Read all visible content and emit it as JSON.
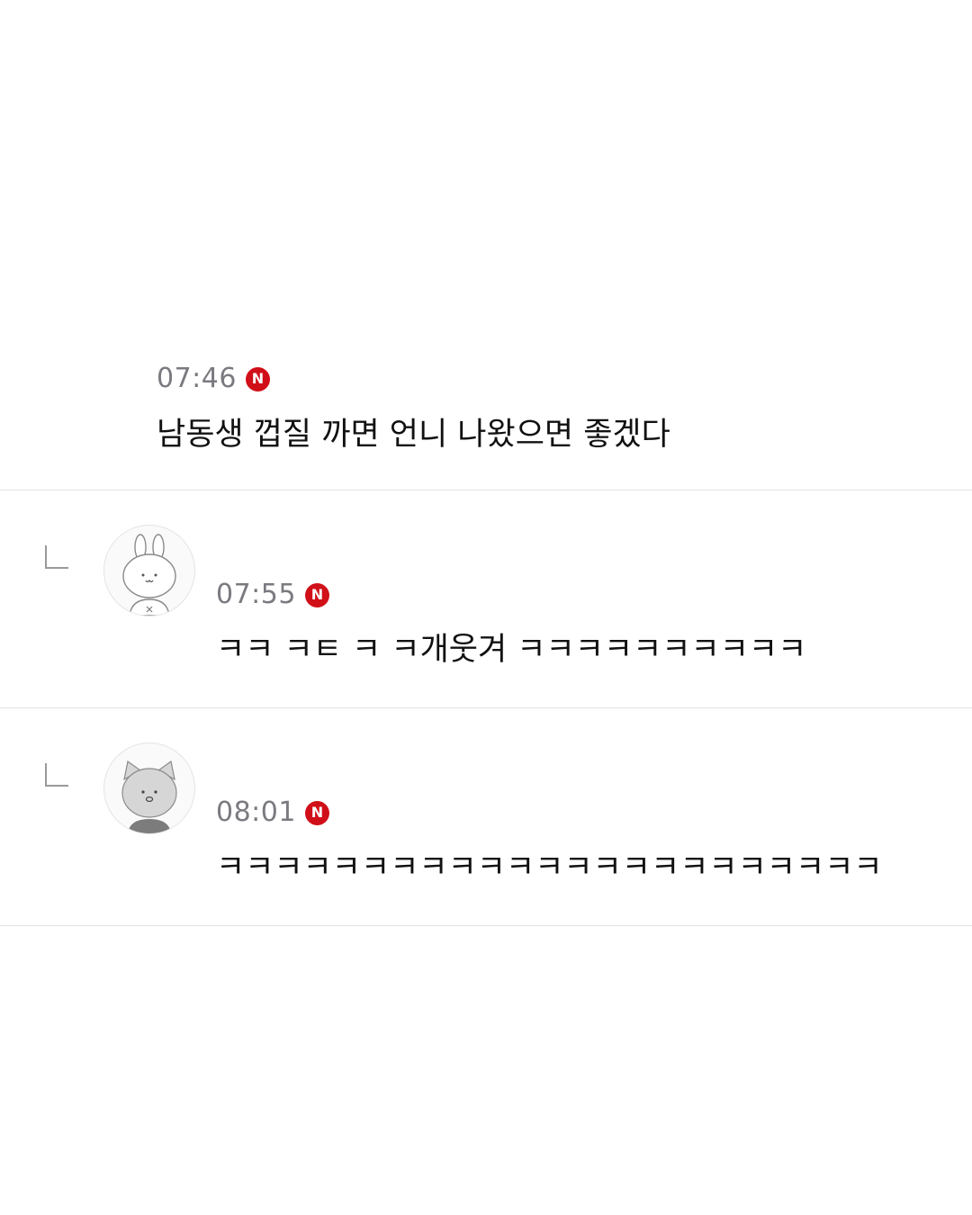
{
  "comments": [
    {
      "time": "07:46",
      "badge": "N",
      "text": "남동생 껍질 까면 언니 나왔으면 좋겠다",
      "accent_color": "#d10f18"
    }
  ],
  "replies": [
    {
      "avatar_icon": "rabbit-avatar-icon",
      "time": "07:55",
      "badge": "N",
      "text": "ㅋㅋ ㅋㅌ ㅋ ㅋ개웃겨 ㅋㅋㅋㅋㅋㅋㅋㅋㅋㅋ"
    },
    {
      "avatar_icon": "cat-avatar-icon",
      "time": "08:01",
      "badge": "N",
      "text": "ㅋㅋㅋㅋㅋㅋㅋㅋㅋㅋㅋㅋㅋㅋㅋㅋㅋㅋㅋㅋㅋㅋㅋ"
    }
  ]
}
